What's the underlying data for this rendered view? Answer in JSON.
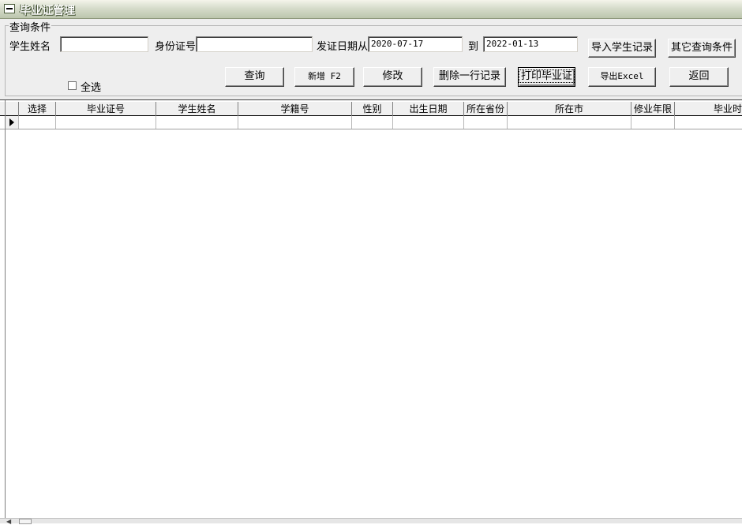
{
  "window": {
    "title": "毕业证管理",
    "icon": "minimize-box-icon"
  },
  "query": {
    "group_label": "查询条件",
    "student_name": {
      "label": "学生姓名",
      "value": ""
    },
    "id_number": {
      "label": "身份证号",
      "value": ""
    },
    "issue_date": {
      "label": "发证日期从",
      "from": "2020-07-17",
      "to_label": "到",
      "to": "2022-01-13"
    },
    "select_all": {
      "label": "全选",
      "checked": false
    }
  },
  "buttons": {
    "import_students": "导入学生记录",
    "other_conditions": "其它查询条件",
    "search": "查询",
    "add": "新增 F2",
    "edit": "修改",
    "delete_row": "删除一行记录",
    "print_certificate": "打印毕业证",
    "export_excel": "导出Excel",
    "back": "返回"
  },
  "grid": {
    "columns": [
      "选择",
      "毕业证号",
      "学生姓名",
      "学籍号",
      "性别",
      "出生日期",
      "所在省份",
      "所在市",
      "修业年限",
      "毕业时"
    ],
    "rows": []
  },
  "colors": {
    "titlebar": "#c8d0bb",
    "panel": "#eeeeee",
    "grid_header": "#f0f0f0"
  }
}
